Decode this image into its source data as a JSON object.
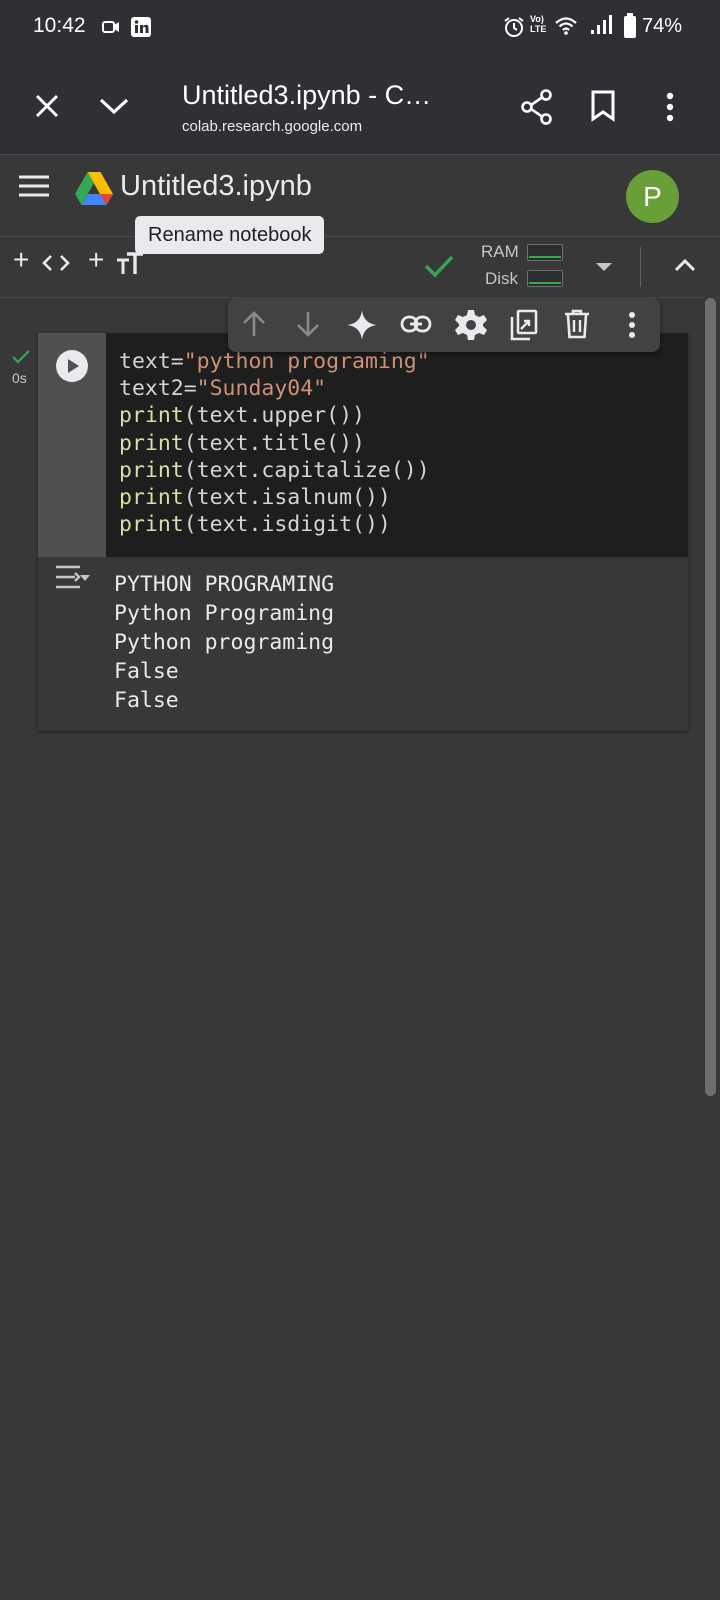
{
  "status_bar": {
    "time": "10:42",
    "battery": "74%",
    "icons": [
      "video-camera-icon",
      "linkedin-icon",
      "alarm-icon",
      "volte-icon",
      "wifi-icon",
      "signal-icon",
      "battery-icon"
    ]
  },
  "browser": {
    "title": "Untitled3.ipynb - C…",
    "url": "colab.research.google.com",
    "icons": [
      "close-icon",
      "chevron-down-icon",
      "share-icon",
      "bookmark-icon",
      "more-vert-icon"
    ]
  },
  "header": {
    "notebook_title": "Untitled3.ipynb",
    "avatar_letter": "P",
    "tooltip": "Rename notebook",
    "menu_icon": "hamburger-menu-icon",
    "logo_icon": "google-drive-logo-icon"
  },
  "toolbar": {
    "add_code": "+",
    "add_text": "+",
    "ram_label": "RAM",
    "disk_label": "Disk",
    "status_color": "#34a853"
  },
  "cell_toolbar": {
    "icons": [
      "move-up-icon",
      "move-down-icon",
      "gemini-sparkle-icon",
      "link-icon",
      "settings-gear-icon",
      "mirror-cell-icon",
      "delete-icon",
      "more-vert-icon"
    ]
  },
  "cell": {
    "exec_time": "0s",
    "code": [
      {
        "parts": [
          {
            "t": "text=",
            "c": "kw-var"
          },
          {
            "t": "\"python programing\"",
            "c": "str"
          }
        ]
      },
      {
        "parts": [
          {
            "t": "text2=",
            "c": "kw-var"
          },
          {
            "t": "\"Sunday04\"",
            "c": "str"
          }
        ]
      },
      {
        "parts": [
          {
            "t": "print",
            "c": "fn"
          },
          {
            "t": "(text.upper())",
            "c": "kw-var"
          }
        ]
      },
      {
        "parts": [
          {
            "t": "print",
            "c": "fn"
          },
          {
            "t": "(text.title())",
            "c": "kw-var"
          }
        ]
      },
      {
        "parts": [
          {
            "t": "print",
            "c": "fn"
          },
          {
            "t": "(text.capitalize())",
            "c": "kw-var"
          }
        ]
      },
      {
        "parts": [
          {
            "t": "print",
            "c": "fn"
          },
          {
            "t": "(text.isalnum())",
            "c": "kw-var"
          }
        ]
      },
      {
        "parts": [
          {
            "t": "print",
            "c": "fn"
          },
          {
            "t": "(text.isdigit())",
            "c": "kw-var"
          }
        ]
      }
    ],
    "output": [
      "PYTHON PROGRAMING",
      "Python Programing",
      "Python programing",
      "False",
      "False"
    ]
  },
  "colors": {
    "background": "#383838",
    "editor_bg": "#1e1e1e",
    "string": "#ce9178",
    "function": "#dcdcaa",
    "accent_green": "#34a853",
    "avatar_green": "#689f38"
  }
}
